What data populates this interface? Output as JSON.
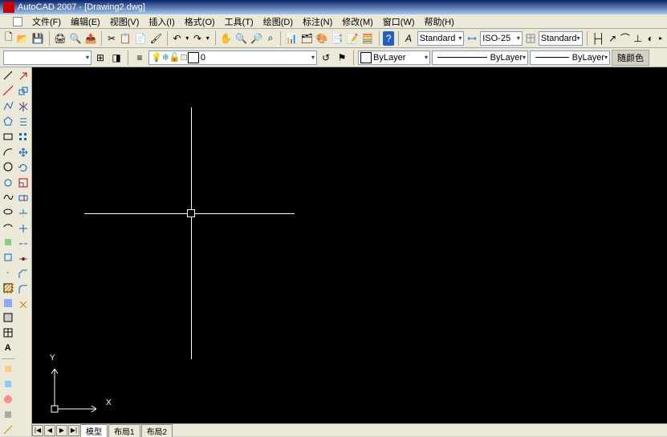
{
  "title": "AutoCAD 2007 - [Drawing2.dwg]",
  "menu": [
    "文件(F)",
    "编辑(E)",
    "视图(V)",
    "插入(I)",
    "格式(O)",
    "工具(T)",
    "绘图(D)",
    "标注(N)",
    "修改(M)",
    "窗口(W)",
    "帮助(H)"
  ],
  "toolbar1": {
    "text_style": "Standard",
    "dim_style": "ISO-25",
    "table_style": "Standard"
  },
  "toolbar2": {
    "layer_state": "0",
    "color": "ByLayer",
    "linetype": "ByLayer",
    "lineweight": "ByLayer",
    "plot_style": "随颜色"
  },
  "ucs": {
    "x": "X",
    "y": "Y"
  },
  "tabs": {
    "model": "模型",
    "layout1": "布局1",
    "layout2": "布局2"
  },
  "nav": {
    "first": "|◀",
    "prev": "◀",
    "next": "▶",
    "last": "▶|"
  }
}
